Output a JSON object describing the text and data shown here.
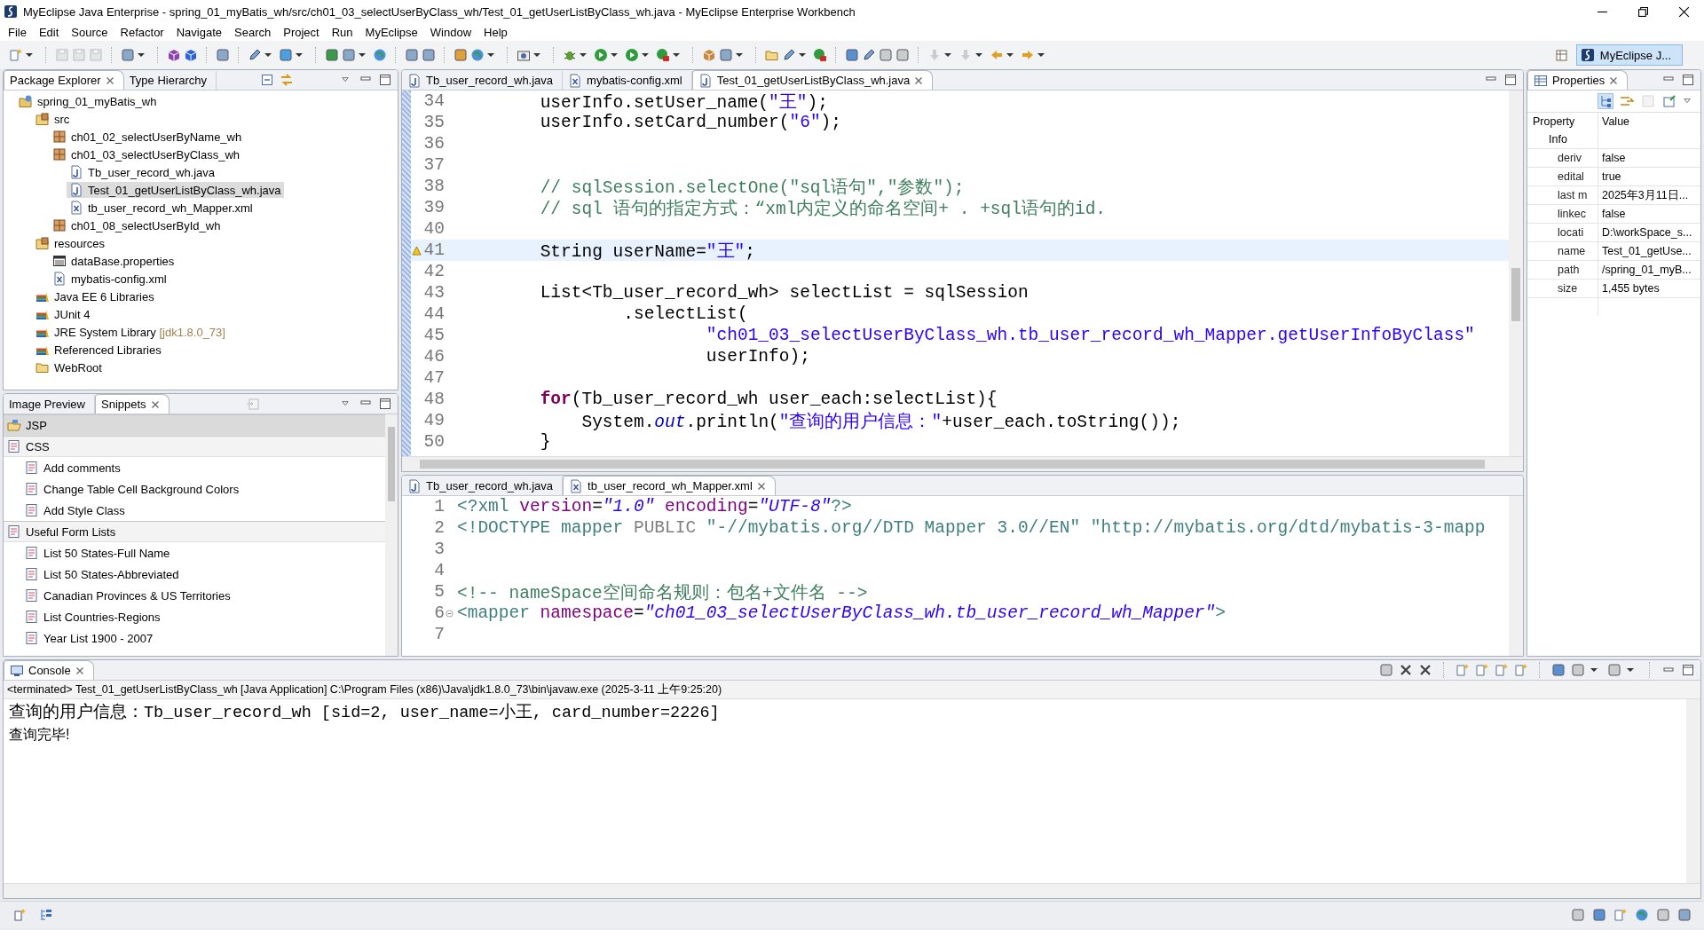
{
  "window": {
    "title": "MyEclipse Java Enterprise - spring_01_myBatis_wh/src/ch01_03_selectUserByClass_wh/Test_01_getUserListByClass_wh.java - MyEclipse Enterprise Workbench"
  },
  "menu": [
    "File",
    "Edit",
    "Source",
    "Refactor",
    "Navigate",
    "Search",
    "Project",
    "Run",
    "MyEclipse",
    "Window",
    "Help"
  ],
  "perspective": {
    "label": "MyEclipse J...",
    "selected": true
  },
  "package_explorer": {
    "tabs": [
      {
        "label": "Package Explorer",
        "selected": true,
        "closable": true
      },
      {
        "label": "Type Hierarchy",
        "selected": false,
        "closable": false
      }
    ],
    "tree": [
      {
        "label": "spring_01_myBatis_wh",
        "kind": "project",
        "selected": false,
        "children": [
          {
            "label": "src",
            "kind": "source",
            "selected": false,
            "children": [
              {
                "label": "ch01_02_selectUserByName_wh",
                "kind": "package",
                "selected": false
              },
              {
                "label": "ch01_03_selectUserByClass_wh",
                "kind": "package",
                "selected": false,
                "children": [
                  {
                    "label": "Tb_user_record_wh.java",
                    "kind": "java",
                    "selected": false
                  },
                  {
                    "label": "Test_01_getUserListByClass_wh.java",
                    "kind": "java",
                    "selected": true
                  },
                  {
                    "label": "tb_user_record_wh_Mapper.xml",
                    "kind": "xml",
                    "selected": false
                  }
                ]
              },
              {
                "label": "ch01_08_selectUserById_wh",
                "kind": "package",
                "selected": false
              }
            ]
          },
          {
            "label": "resources",
            "kind": "source",
            "selected": false,
            "children": [
              {
                "label": "dataBase.properties",
                "kind": "properties",
                "selected": false
              },
              {
                "label": "mybatis-config.xml",
                "kind": "xml",
                "selected": false
              }
            ]
          },
          {
            "label": "Java EE 6 Libraries",
            "kind": "library",
            "selected": false
          },
          {
            "label": "JUnit 4",
            "kind": "library",
            "selected": false
          },
          {
            "label": "JRE System Library",
            "decoration": "[jdk1.8.0_73]",
            "kind": "library",
            "selected": false
          },
          {
            "label": "Referenced Libraries",
            "kind": "library",
            "selected": false
          },
          {
            "label": "WebRoot",
            "kind": "folder",
            "selected": false
          }
        ]
      }
    ]
  },
  "snippets": {
    "tabs": [
      {
        "label": "Image Preview",
        "selected": false,
        "closable": false
      },
      {
        "label": "Snippets",
        "selected": true,
        "closable": true
      }
    ],
    "categories": [
      {
        "label": "JSP",
        "selected": true
      },
      {
        "label": "CSS",
        "selected": false,
        "items": [
          "Add comments",
          "Change Table Cell Background Colors",
          "Add Style Class"
        ]
      },
      {
        "label": "Useful Form Lists",
        "selected": false,
        "items": [
          "List 50 States-Full Name",
          "List 50 States-Abbreviated",
          "Canadian Provinces & US Territories",
          "List Countries-Regions",
          "Year List 1900 - 2007"
        ]
      }
    ]
  },
  "editor": {
    "tabs": [
      {
        "label": "Tb_user_record_wh.java",
        "kind": "java",
        "selected": false,
        "closable": false
      },
      {
        "label": "mybatis-config.xml",
        "kind": "xml",
        "selected": false,
        "closable": false
      },
      {
        "label": "Test_01_getUserListByClass_wh.java",
        "kind": "java",
        "selected": true,
        "closable": true
      }
    ],
    "lines": [
      {
        "number": "34",
        "segments": [
          {
            "kind": "plain",
            "text": "\t\tuserInfo.setUser_name("
          },
          {
            "kind": "string",
            "text": "\"王\""
          },
          {
            "kind": "plain",
            "text": ");"
          }
        ]
      },
      {
        "number": "35",
        "segments": [
          {
            "kind": "plain",
            "text": "\t\tuserInfo.setCard_number("
          },
          {
            "kind": "string",
            "text": "\"6\""
          },
          {
            "kind": "plain",
            "text": ");"
          }
        ]
      },
      {
        "number": "36"
      },
      {
        "number": "37"
      },
      {
        "number": "38",
        "segments": [
          {
            "kind": "comment",
            "text": "\t\t// sqlSession.selectOne(\"sql语句\",\"参数\");"
          }
        ]
      },
      {
        "number": "39",
        "segments": [
          {
            "kind": "comment",
            "text": "\t\t// sql 语句的指定方式：“xml内定义的命名空间+ . +sql语句的id."
          }
        ]
      },
      {
        "number": "40"
      },
      {
        "number": "41",
        "current": true,
        "warning": true,
        "segments": [
          {
            "kind": "plain",
            "text": "\t\tString userName="
          },
          {
            "kind": "string",
            "text": "\"王\""
          },
          {
            "kind": "plain",
            "text": ";"
          }
        ]
      },
      {
        "number": "42"
      },
      {
        "number": "43",
        "segments": [
          {
            "kind": "plain",
            "text": "\t\tList<Tb_user_record_wh> selectList = sqlSession"
          }
        ]
      },
      {
        "number": "44",
        "segments": [
          {
            "kind": "plain",
            "text": "\t\t\t\t.selectList("
          }
        ]
      },
      {
        "number": "45",
        "segments": [
          {
            "kind": "string",
            "text": "\t\t\t\t\t\t\"ch01_03_selectUserByClass_wh.tb_user_record_wh_Mapper.getUserInfoByClass\""
          }
        ]
      },
      {
        "number": "46",
        "segments": [
          {
            "kind": "plain",
            "text": "\t\t\t\t\t\tuserInfo);"
          }
        ]
      },
      {
        "number": "47"
      },
      {
        "number": "48",
        "segments": [
          {
            "kind": "keyword",
            "text": "\t\tfor"
          },
          {
            "kind": "plain",
            "text": "(Tb_user_record_wh user_each:selectList){"
          }
        ]
      },
      {
        "number": "49",
        "segments": [
          {
            "kind": "plain",
            "text": "\t\t\tSystem."
          },
          {
            "kind": "field",
            "text": "out"
          },
          {
            "kind": "plain",
            "text": ".println("
          },
          {
            "kind": "string",
            "text": "\"查询的用户信息：\""
          },
          {
            "kind": "plain",
            "text": "+user_each.toString());"
          }
        ]
      },
      {
        "number": "50",
        "segments": [
          {
            "kind": "plain",
            "text": "\t\t}"
          }
        ]
      }
    ]
  },
  "xml_editor": {
    "tabs": [
      {
        "label": "Tb_user_record_wh.java",
        "kind": "java",
        "selected": false,
        "closable": false
      },
      {
        "label": "tb_user_record_wh_Mapper.xml",
        "kind": "xml",
        "selected": true,
        "closable": true
      }
    ],
    "lines": [
      {
        "number": "1",
        "segments": [
          {
            "kind": "tag",
            "text": "<?xml"
          },
          {
            "kind": "attr",
            "text": " version"
          },
          {
            "kind": "plain",
            "text": "="
          },
          {
            "kind": "value",
            "text": "\"1.0\""
          },
          {
            "kind": "attr",
            "text": " encoding"
          },
          {
            "kind": "plain",
            "text": "="
          },
          {
            "kind": "value",
            "text": "\"UTF-8\""
          },
          {
            "kind": "tag",
            "text": "?>"
          }
        ]
      },
      {
        "number": "2",
        "segments": [
          {
            "kind": "tag",
            "text": "<!DOCTYPE mapper "
          },
          {
            "kind": "muted",
            "text": "PUBLIC "
          },
          {
            "kind": "tag",
            "text": "\"-//mybatis.org//DTD Mapper 3.0//EN\" \"http://mybatis.org/dtd/mybatis-3-mapp"
          }
        ]
      },
      {
        "number": "3"
      },
      {
        "number": "4"
      },
      {
        "number": "5",
        "segments": [
          {
            "kind": "comment",
            "text": "<!-- nameSpace空间命名规则：包名+文件名 -->"
          }
        ]
      },
      {
        "number": "6",
        "foldable": true,
        "segments": [
          {
            "kind": "tag",
            "text": "<mapper"
          },
          {
            "kind": "attr",
            "text": " namespace"
          },
          {
            "kind": "plain",
            "text": "="
          },
          {
            "kind": "value",
            "text": "\"ch01_03_selectUserByClass_wh.tb_user_record_wh_Mapper\""
          },
          {
            "kind": "tag",
            "text": ">"
          }
        ]
      },
      {
        "number": "7"
      }
    ]
  },
  "properties": {
    "tab": {
      "label": "Properties",
      "closable": true
    },
    "columns": [
      "Property",
      "Value"
    ],
    "group": "Info",
    "rows": [
      {
        "property": "deriv",
        "value": "false"
      },
      {
        "property": "edital",
        "value": "true"
      },
      {
        "property": "last m",
        "value": "2025年3月11日..."
      },
      {
        "property": "linkec",
        "value": "false"
      },
      {
        "property": "locati",
        "value": "D:\\workSpace_s..."
      },
      {
        "property": "name",
        "value": "Test_01_getUse..."
      },
      {
        "property": "path",
        "value": "/spring_01_myB..."
      },
      {
        "property": "size",
        "value": "1,455  bytes"
      }
    ]
  },
  "console": {
    "tab": {
      "label": "Console",
      "closable": true
    },
    "header": "<terminated> Test_01_getUserListByClass_wh [Java Application] C:\\Program Files (x86)\\Java\\jdk1.8.0_73\\bin\\javaw.exe (2025-3-11 上午9:25:20)",
    "output": [
      "查询的用户信息：Tb_user_record_wh [sid=2, user_name=小王, card_number=2226]",
      "查询完毕!"
    ]
  }
}
